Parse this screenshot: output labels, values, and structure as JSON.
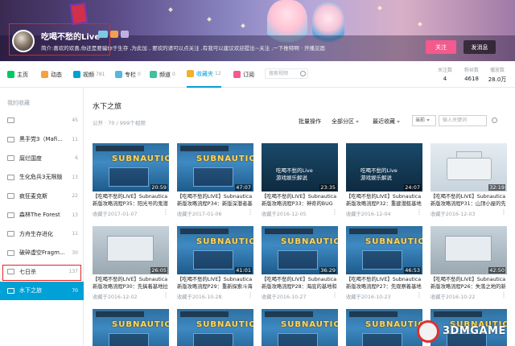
{
  "header": {
    "username": "吃喝不愁的Live",
    "signature": "简介:喜欢的欢喜,你还是要骗你于生存 ,为此加 , 要欢的请可以点关注 ,有我可以建议欢迎提出~关注 ,一下推特啊 · 开播见面",
    "follow_label": "关注",
    "message_label": "发消息"
  },
  "nav": {
    "tabs": [
      {
        "label": "主页",
        "count": "",
        "icon": "home-icon"
      },
      {
        "label": "动态",
        "count": "",
        "icon": "dynamic-icon"
      },
      {
        "label": "视频",
        "count": "781",
        "icon": "video-icon"
      },
      {
        "label": "专栏",
        "count": "0",
        "icon": "column-icon"
      },
      {
        "label": "频道",
        "count": "0",
        "icon": "channel-icon"
      },
      {
        "label": "收藏夹",
        "count": "12",
        "icon": "favorite-icon"
      },
      {
        "label": "订阅",
        "count": "",
        "icon": "subscribe-icon"
      }
    ],
    "search_placeholder": "搜索视频",
    "stats": [
      {
        "label": "关注数",
        "value": "4"
      },
      {
        "label": "粉丝数",
        "value": "4618"
      },
      {
        "label": "播放数",
        "value": "28.0万"
      }
    ]
  },
  "sidebar": {
    "title": "我的收藏",
    "items": [
      {
        "label": "",
        "count": "45"
      },
      {
        "label": "黑手党3（Mafi...",
        "count": "11"
      },
      {
        "label": "腐烂国度",
        "count": "6"
      },
      {
        "label": "生化危兵3无限版",
        "count": "13"
      },
      {
        "label": "疯狂麦克斯",
        "count": "22"
      },
      {
        "label": "森林The Forest",
        "count": "13"
      },
      {
        "label": "方舟生存进化",
        "count": "11"
      },
      {
        "label": "破碎虚空Fragm...",
        "count": "30"
      },
      {
        "label": "七日杀",
        "count": "137"
      },
      {
        "label": "水下之旅",
        "count": "70"
      }
    ]
  },
  "main": {
    "folder_title": "水下之旅",
    "folder_meta": "公开 · 70 / 999个视频",
    "batch_label": "批量操作",
    "zone_label": "全部分区",
    "sort_label": "最近收藏",
    "scope_select": "当前",
    "keyword_placeholder": "输入关键词",
    "videos": [
      {
        "title": "【吃喝不愁的LIVE】Subnautica新版攻略流程P35：阳光号的鬼潜",
        "date": "收藏于2017-01-07",
        "duration": "20:59",
        "style": "sn"
      },
      {
        "title": "【吃喝不愁的LIVE】Subnautica新版攻略流程P34：新版深潜者基地",
        "date": "收藏于2017-01-06",
        "duration": "47:07",
        "style": "sn"
      },
      {
        "title": "【吃喝不愁的LIVE】Subnautica新版攻略流程P33：神奇的BUG",
        "date": "收藏于2016-12-05",
        "duration": "23:35",
        "style": "dark"
      },
      {
        "title": "【吃喝不愁的LIVE】Subnautica新版攻略流程P32：重建潜艇基地机",
        "date": "收藏于2016-12-04",
        "duration": "24:07",
        "style": "dark"
      },
      {
        "title": "【吃喝不愁的LIVE】Subnautica新版攻略流程P31：山顶小屋的先居",
        "date": "收藏于2016-12-03",
        "duration": "32:19",
        "style": "car"
      },
      {
        "title": "【吃喝不愁的LIVE】Subnautica新版攻略流程P30：先搞着基地拉了",
        "date": "收藏于2016-12-02",
        "duration": "26:05",
        "style": "box3d"
      },
      {
        "title": "【吃喝不愁的LIVE】Subnautica新版攻略流程P29：重新探索斗海区",
        "date": "收藏于2016-10-28",
        "duration": "41:01",
        "style": "sn"
      },
      {
        "title": "【吃喝不愁的LIVE】Subnautica新版攻略流程P28：海底的基地和新",
        "date": "收藏于2016-10-27",
        "duration": "36:29",
        "style": "sn"
      },
      {
        "title": "【吃喝不愁的LIVE】Subnautica新版攻略流程P27：先观察着基地是",
        "date": "收藏于2016-10-23",
        "duration": "46:53",
        "style": "sn"
      },
      {
        "title": "【吃喝不愁的LIVE】Subnautica新版攻略流程P26：失落之地的新生",
        "date": "收藏于2016-10-22",
        "duration": "42:50",
        "style": "box3d"
      },
      {
        "title": "",
        "date": "",
        "duration": "",
        "style": "sn"
      },
      {
        "title": "",
        "date": "",
        "duration": "",
        "style": "sn"
      },
      {
        "title": "",
        "date": "",
        "duration": "",
        "style": "sn"
      },
      {
        "title": "",
        "date": "",
        "duration": "",
        "style": "sn"
      },
      {
        "title": "",
        "date": "",
        "duration": "",
        "style": "sn"
      }
    ],
    "thumb_logo": "SUBNAUTICA",
    "thumb_caption": "吃喝不愁的Live\n游戏娱乐解说"
  },
  "watermark": "3DMGAME",
  "colors": {
    "accent": "#00a1d6",
    "follow": "#f45a8d",
    "highlight": "#e02424"
  }
}
